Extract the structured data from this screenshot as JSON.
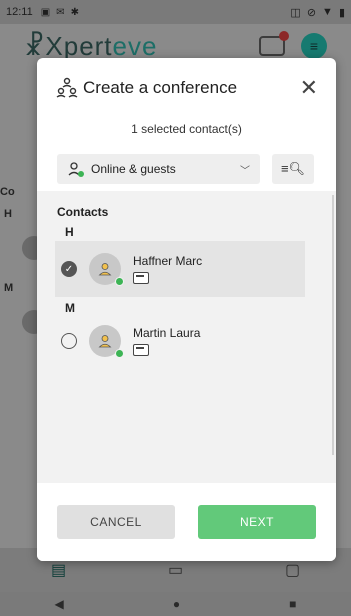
{
  "status_bar": {
    "time": "12:11",
    "left_icons": [
      "image-icon",
      "mail-icon",
      "app-icon"
    ],
    "right_icons": [
      "briefcase-icon",
      "mute-icon",
      "wifi-icon",
      "battery-icon"
    ]
  },
  "app": {
    "logo_prefix": "Xpert",
    "logo_suffix": "eve",
    "bottom_tabs": [
      "contacts-tab",
      "chat-tab",
      "video-tab"
    ]
  },
  "dialog": {
    "title": "Create a conference",
    "selected_count": "1 selected contact(s)",
    "filter": {
      "selected": "Online & guests"
    },
    "contacts_heading": "Contacts",
    "groups": [
      {
        "letter": "H",
        "contacts": [
          {
            "name": "Haffner Marc",
            "selected": true,
            "status": "online"
          }
        ]
      },
      {
        "letter": "M",
        "contacts": [
          {
            "name": "Martin Laura",
            "selected": false,
            "status": "online"
          }
        ]
      }
    ],
    "cancel_label": "CANCEL",
    "next_label": "NEXT"
  },
  "colors": {
    "accent_green": "#62c97a",
    "online_green": "#3db455",
    "brand_teal": "#167a70"
  }
}
